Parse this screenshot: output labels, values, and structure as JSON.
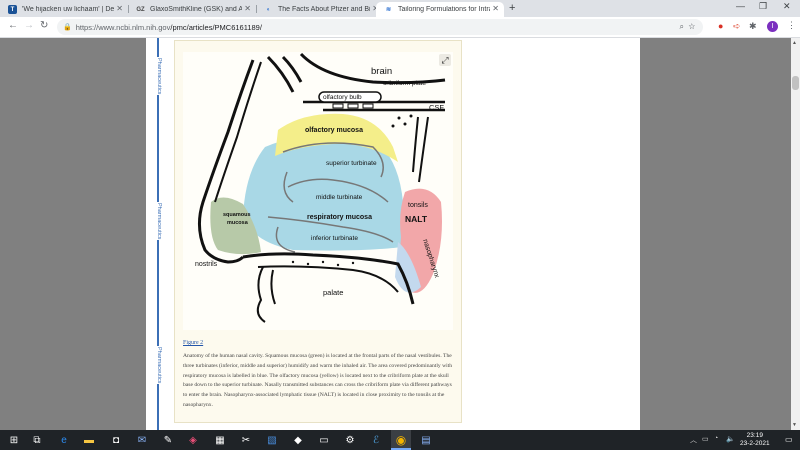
{
  "tabs": [
    {
      "label": "'We hijacken uw lichaam' | De Tijd",
      "favicon": "T",
      "favicon_color": "#1a5296"
    },
    {
      "label": "GlaxoSmithKline (GSK) and Alpha",
      "favicon": "GZ",
      "favicon_color": "#444444"
    },
    {
      "label": "The Facts About Pfizer and BioN",
      "favicon": "◐",
      "favicon_color": "#2a6fd1"
    },
    {
      "label": "Tailoring Formulations for Intran",
      "favicon": "≋",
      "favicon_color": "#2a6fd1"
    }
  ],
  "omnibox": {
    "url_host": "https://www.ncbi.nlm.nih.gov",
    "url_path": "/pmc/articles/PMC6161189/"
  },
  "side_labels": [
    "Pharmaceutics",
    "Pharmaceutics",
    "Pharmaceutics"
  ],
  "figure": {
    "labels": {
      "brain": "brain",
      "cribriform_plate": "cribriform plate",
      "olfactory_bulb": "olfactory bulb",
      "csf": "CSF",
      "olfactory_mucosa": "olfactory mucosa",
      "superior_turbinate": "superior  turbinate",
      "middle_turbinate": "middle turbinate",
      "respiratory_mucosa": "respiratory mucosa",
      "tonsils": "tonsils",
      "nalt": "NALT",
      "squamous_mucosa_1": "squamous",
      "squamous_mucosa_2": "mucosa",
      "inferior_turbinate": "inferior turbinate",
      "nostrils": "nostrils",
      "nasopharynx": "nasopharynx",
      "palate": "palate"
    },
    "colors": {
      "olfactory": "#f4ee8a",
      "respiratory": "#a9d8e6",
      "squamous": "#b7c9a8",
      "nalt": "#f2a7a9"
    },
    "link": "Figure 2",
    "caption": "Anatomy of the human nasal cavity. Squamous mucosa (green) is located at the frontal parts of the nasal vestibules. The three turbinates (inferior, middle and superior) humidify and warm the inhaled air. The area covered predominantly with respiratory mucosa is labelled in blue. The olfactory mucosa (yellow) is located next to the cribriform plate at the skull base down to the superior turbinate. Nasally transmitted substances can cross the cribriform plate via different pathways to enter the brain. Nasopharynx-associated lymphatic tissue (NALT) is located in close proximity to the tonsils at the nasopharynx."
  },
  "taskbar": {
    "time": "23:19",
    "date": "23-2-2021"
  }
}
